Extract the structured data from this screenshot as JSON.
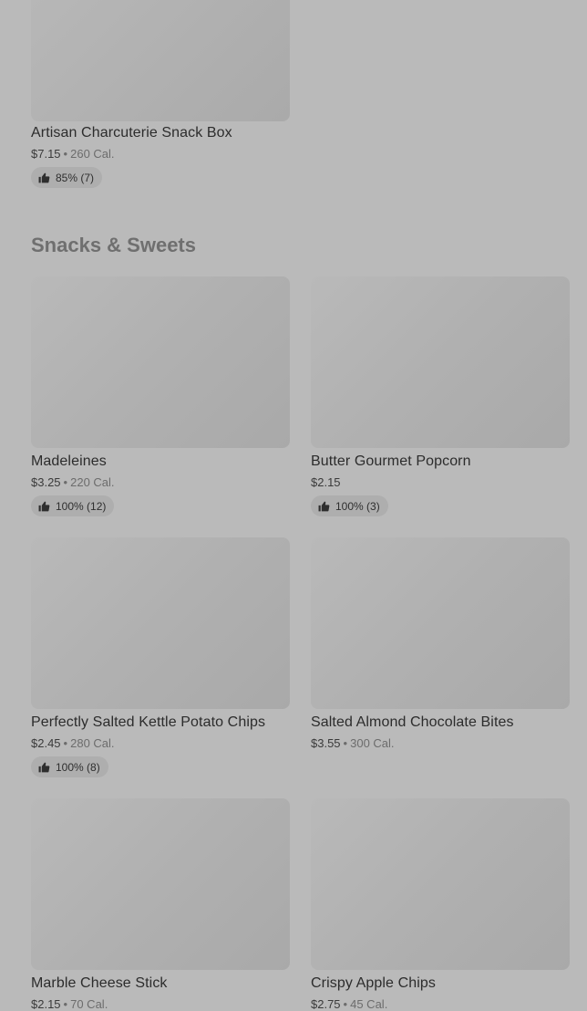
{
  "section": {
    "title": "Snacks & Sweets"
  },
  "top_item": {
    "name": "Artisan Charcuterie Snack Box",
    "price": "$7.15",
    "calories": "260 Cal.",
    "rating": "85% (7)"
  },
  "items": [
    {
      "name": "Madeleines",
      "price": "$3.25",
      "calories": "220 Cal.",
      "rating": "100% (12)"
    },
    {
      "name": "Butter Gourmet Popcorn",
      "price": "$2.15",
      "calories": "",
      "rating": "100% (3)"
    },
    {
      "name": "Perfectly Salted Kettle Potato Chips",
      "price": "$2.45",
      "calories": "280 Cal.",
      "rating": "100% (8)"
    },
    {
      "name": "Salted Almond Chocolate Bites",
      "price": "$3.55",
      "calories": "300 Cal.",
      "rating": ""
    },
    {
      "name": "Marble Cheese Stick",
      "price": "$2.15",
      "calories": "70 Cal.",
      "rating": ""
    },
    {
      "name": "Crispy Apple Chips",
      "price": "$2.75",
      "calories": "45 Cal.",
      "rating": ""
    }
  ],
  "separator": "•",
  "icons": {
    "rating": "thumbs-up-icon"
  },
  "colors": {
    "overlay_background": "#bababa",
    "section_title": "#6f6f6f"
  }
}
